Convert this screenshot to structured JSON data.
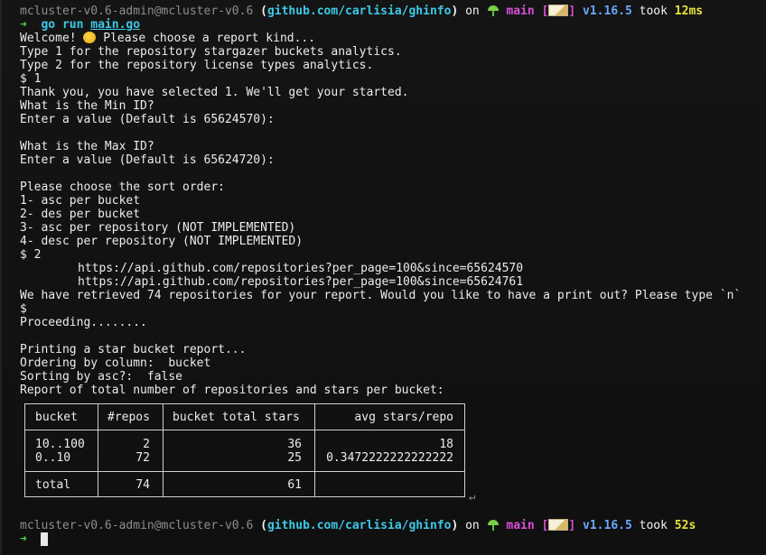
{
  "prompt1": {
    "user_host": "mcluster-v0.6-admin@mcluster-v0.6",
    "paren_open": "(",
    "paren_close": ")",
    "repo": "github.com/carlisia/ghinfo",
    "on": "on",
    "branch": "main",
    "bracket_open": "[",
    "bracket_close": "]",
    "go_version": "v1.16.5",
    "took": "took",
    "duration": "12ms"
  },
  "command": {
    "arrow": "➜",
    "go": "go",
    "run": "run",
    "file": "main.go"
  },
  "output": {
    "welcome_prefix": "Welcome! ",
    "welcome_suffix": " Please choose a report kind...",
    "type1": "Type 1 for the repository stargazer buckets analytics.",
    "type2": "Type 2 for the repository license types analytics.",
    "answer1": "$ 1",
    "selected": "Thank you, you have selected 1. We'll get your started.",
    "min_q": "What is the Min ID?",
    "min_prompt": "Enter a value (Default is 65624570):",
    "max_q": "What is the Max ID?",
    "max_prompt": "Enter a value (Default is 65624720):",
    "sort_q": "Please choose the sort order:",
    "sort1": "1- asc per bucket",
    "sort2": "2- des per bucket",
    "sort3": "3- asc per repository (NOT IMPLEMENTED)",
    "sort4": "4- desc per repository (NOT IMPLEMENTED)",
    "answer2": "$ 2",
    "url1": "https://api.github.com/repositories?per_page=100&since=65624570",
    "url2": "https://api.github.com/repositories?per_page=100&since=65624761",
    "retrieved": "We have retrieved 74 repositories for your report. Would you like to have a print out? Please type `n`",
    "answer3": "$",
    "proceeding": "Proceeding........",
    "printing": "Printing a star bucket report...",
    "ordering": "Ordering by column:  bucket",
    "sorting": "Sorting by asc?:  false",
    "report": "Report of total number of repositories and stars per bucket:"
  },
  "table": {
    "headers": [
      "bucket",
      "#repos",
      "bucket total stars",
      "avg stars/repo"
    ],
    "rows": [
      [
        "10..100",
        "2",
        "36",
        "18"
      ],
      [
        "0..10",
        "72",
        "25",
        "0.3472222222222222"
      ]
    ],
    "footer": [
      "total",
      "74",
      "61",
      ""
    ]
  },
  "return_symbol": "↵",
  "prompt2": {
    "user_host": "mcluster-v0.6-admin@mcluster-v0.6",
    "paren_open": "(",
    "paren_close": ")",
    "repo": "github.com/carlisia/ghinfo",
    "on": "on",
    "branch": "main",
    "bracket_open": "[",
    "bracket_close": "]",
    "go_version": "v1.16.5",
    "took": "took",
    "duration": "52s"
  },
  "prompt3": {
    "arrow": "➜"
  },
  "icons": {
    "smiley": "smiley-emoji-icon",
    "branch": "seedling-icon",
    "status": "memo-icon"
  }
}
